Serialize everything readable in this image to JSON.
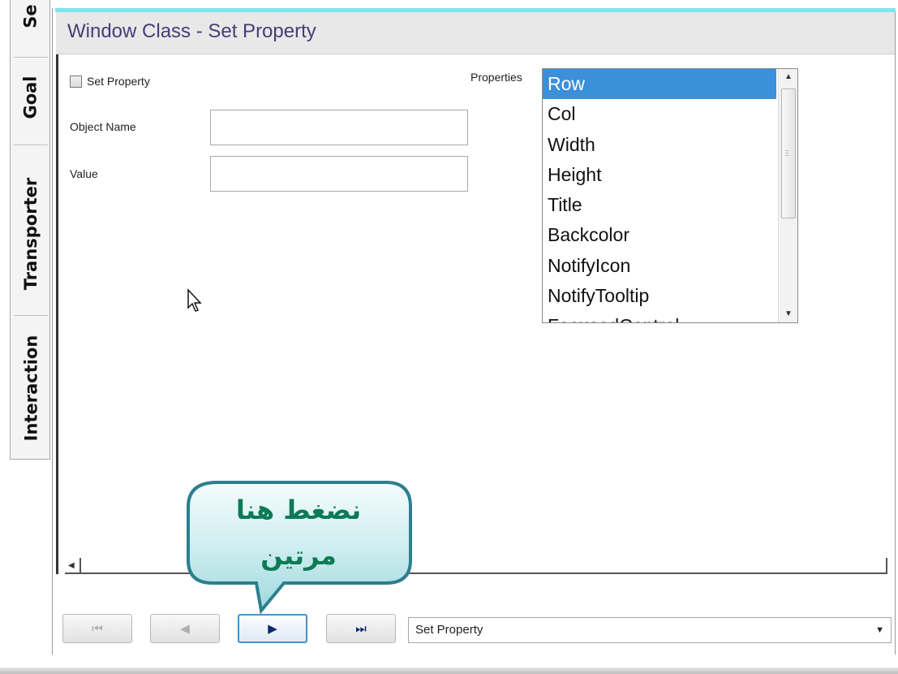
{
  "side_tabs": [
    "Se",
    "Goal",
    "Transporter",
    "Interaction"
  ],
  "header": {
    "title": "Window Class - Set Property"
  },
  "form": {
    "set_property_checkbox_label": "Set Property",
    "object_name_label": "Object Name",
    "object_name_value": "",
    "value_label": "Value",
    "value_value": ""
  },
  "properties": {
    "label": "Properties",
    "items": [
      "Row",
      "Col",
      "Width",
      "Height",
      "Title",
      "Backcolor",
      "NotifyIcon",
      "NotifyTooltip",
      "FocusedControl"
    ],
    "selected": "Row"
  },
  "nav": {
    "first": "⏮",
    "prev": "◀",
    "next": "▶",
    "last": "⏭",
    "step_select_value": "Set Property"
  },
  "callout": {
    "line1": "نضغط هنا",
    "line2": "مرتين"
  },
  "colors": {
    "title_text": "#4a3b7a",
    "selection": "#3c8fd9",
    "callout_text": "#0d7a55",
    "callout_fill": "#cfeef0"
  }
}
